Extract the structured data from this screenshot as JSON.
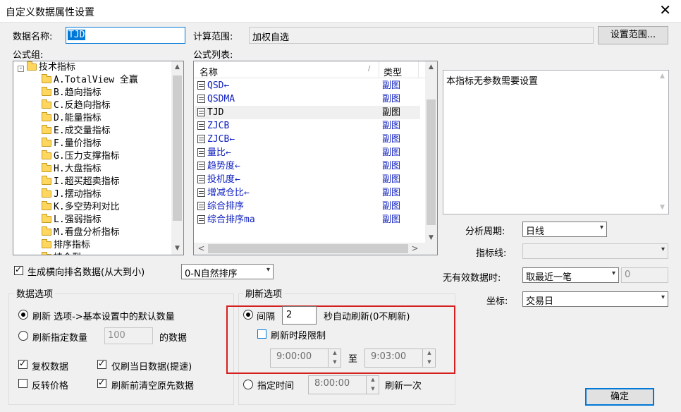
{
  "window": {
    "title": "自定义数据属性设置",
    "close_icon": "close-icon"
  },
  "fields": {
    "data_name_label": "数据名称:",
    "data_name_value": "TJD",
    "calc_range_label": "计算范围:",
    "calc_range_value": "加权自选",
    "set_range_button": "设置范围..."
  },
  "formula_group": {
    "label": "公式组:",
    "root": "技术指标",
    "items": [
      "A.TotalView 全赢",
      "B.趋向指标",
      "C.反趋向指标",
      "D.能量指标",
      "E.成交量指标",
      "F.量价指标",
      "G.压力支撑指标",
      "H.大盘指标",
      "I.超买超卖指标",
      "J.摆动指标",
      "K.多空势利对比",
      "L.强弱指标",
      "M.看盘分析指标",
      "排序指标",
      "持仓型"
    ]
  },
  "formula_list": {
    "label": "公式列表:",
    "col_name": "名称",
    "col_type": "类型",
    "rows": [
      {
        "name": "QSD←",
        "type": "副图"
      },
      {
        "name": "QSDMA",
        "type": "副图"
      },
      {
        "name": "TJD",
        "type": "副图"
      },
      {
        "name": "ZJCB",
        "type": "副图"
      },
      {
        "name": "ZJCB←",
        "type": "副图"
      },
      {
        "name": "量比←",
        "type": "副图"
      },
      {
        "name": "趋势度←",
        "type": "副图"
      },
      {
        "name": "投机度←",
        "type": "副图"
      },
      {
        "name": "增减仓比←",
        "type": "副图"
      },
      {
        "name": "综合排序",
        "type": "副图"
      },
      {
        "name": "综合排序ma",
        "type": "副图"
      }
    ],
    "selected_index": 2
  },
  "param_box": {
    "text": "本指标无参数需要设置"
  },
  "right_settings": {
    "period_label": "分析周期:",
    "period_value": "日线",
    "indicator_line_label": "指标线:",
    "indicator_line_value": "",
    "invalid_label": "无有效数据时:",
    "invalid_value": "取最近一笔",
    "invalid_number": "0",
    "coord_label": "坐标:",
    "coord_value": "交易日"
  },
  "horizontal_rank": {
    "checkbox_label": "生成横向排名数据(从大到小)",
    "checked": true,
    "sort_value": "0-N自然排序"
  },
  "data_options": {
    "title": "数据选项",
    "radio1": "刷新 选项->基本设置中的默认数量",
    "radio2": "刷新指定数量",
    "count_value": "100",
    "count_suffix": "的数据",
    "cb_fuquan": "复权数据",
    "cb_today": "仅刷当日数据(提速)",
    "cb_reverse": "反转价格",
    "cb_clear": "刷新前清空原先数据"
  },
  "refresh_options": {
    "title": "刷新选项",
    "interval_label": "间隔",
    "interval_value": "2",
    "interval_suffix": "秒自动刷新(0不刷新)",
    "time_limit_label": "刷新时段限制",
    "start_time": "9:00:00",
    "to_label": "至",
    "end_time": "9:03:00",
    "fixed_time_label": "指定时间",
    "fixed_time_value": "8:00:00",
    "fixed_time_suffix": "刷新一次"
  },
  "ok_button": "确定"
}
